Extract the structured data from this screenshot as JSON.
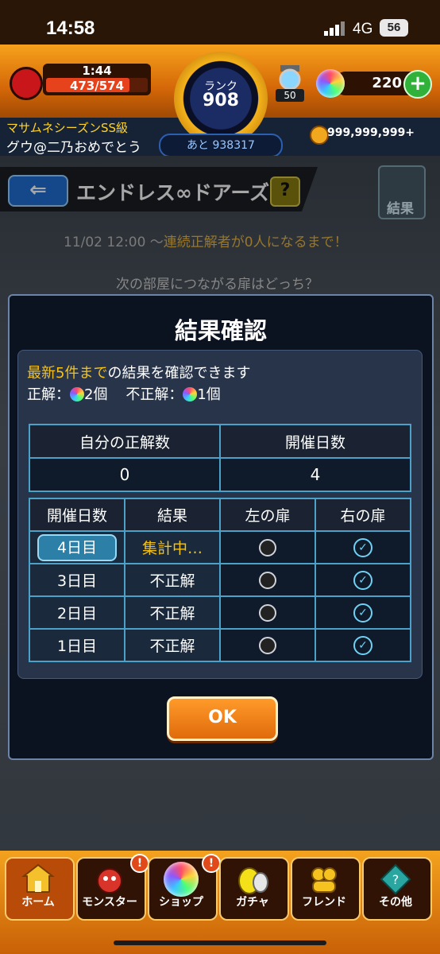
{
  "status_bar": {
    "time": "14:58",
    "network": "4G",
    "battery": "56"
  },
  "header": {
    "stamina_timer": "1:44",
    "stamina": "473/574",
    "stamina_level": 0.82,
    "rank_label": "ランク",
    "rank_value": "908",
    "rank_next": "あと 938317",
    "lantern_count": "50",
    "orb_count": "220",
    "season": "マサムネシーズンSS級",
    "player_name": "グウ@二乃おめでとう",
    "coins": "999,999,999+"
  },
  "event": {
    "title": "エンドレス∞ドアーズ",
    "help_label": "?",
    "result_label": "結果",
    "period_date": "11/02 12:00 ～",
    "period_text": "連続正解者が0人になるまで！",
    "question": "次の部屋につながる扉はどっち？"
  },
  "modal": {
    "title": "結果確認",
    "info_highlight": "最新5件まで",
    "info_rest": "の結果を確認できます",
    "correct_label": "正解：",
    "correct_value": "2個",
    "incorrect_label": "不正解：",
    "incorrect_value": "1個",
    "summary_headers": [
      "自分の正解数",
      "開催日数"
    ],
    "summary_values": [
      "0",
      "4"
    ],
    "history_headers": [
      "開催日数",
      "結果",
      "左の扉",
      "右の扉"
    ],
    "history_rows": [
      {
        "day": "4日目",
        "result": "集計中…",
        "left": "empty",
        "right": "check"
      },
      {
        "day": "3日目",
        "result": "不正解",
        "left": "empty",
        "right": "check"
      },
      {
        "day": "2日目",
        "result": "不正解",
        "left": "empty",
        "right": "check"
      },
      {
        "day": "1日目",
        "result": "不正解",
        "left": "empty",
        "right": "check"
      }
    ],
    "ok_label": "OK"
  },
  "nav": {
    "items": [
      {
        "label": "ホーム",
        "icon": "home-icon",
        "badge": ""
      },
      {
        "label": "モンスター",
        "icon": "monster-icon",
        "badge": "!"
      },
      {
        "label": "ショップ",
        "icon": "shop-orb-icon",
        "badge": "!"
      },
      {
        "label": "ガチャ",
        "icon": "gacha-egg-icon",
        "badge": ""
      },
      {
        "label": "フレンド",
        "icon": "friend-icon",
        "badge": ""
      },
      {
        "label": "その他",
        "icon": "other-icon",
        "badge": ""
      }
    ]
  },
  "colors": {
    "accent_orange": "#f08a16",
    "highlight_yellow": "#f5c21a",
    "table_border": "#4ba1c7"
  }
}
